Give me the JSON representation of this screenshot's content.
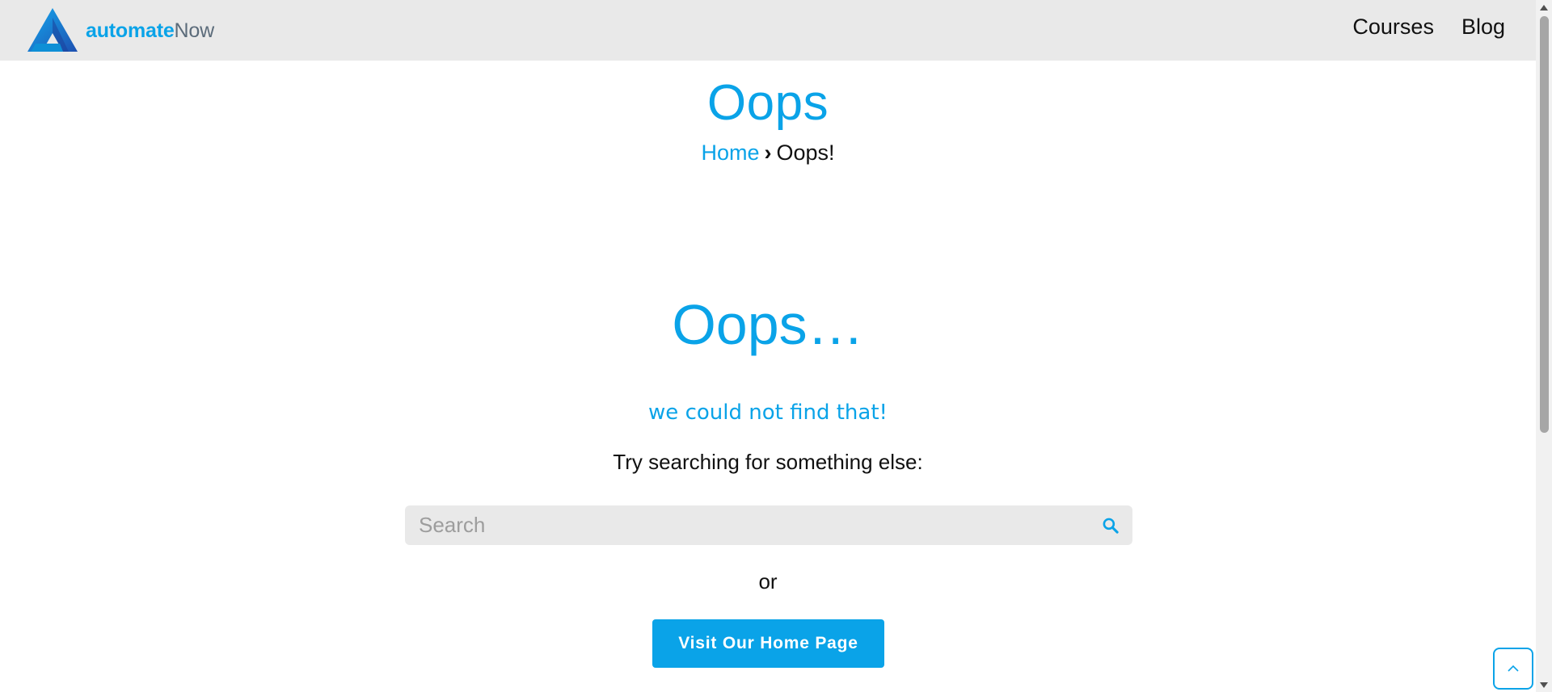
{
  "header": {
    "logo_text_bold": "automate",
    "logo_text_light": "Now",
    "nav": [
      {
        "label": "Courses"
      },
      {
        "label": "Blog"
      }
    ]
  },
  "page_title": "Oops",
  "breadcrumb": {
    "home": "Home",
    "separator": "›",
    "current": "Oops!"
  },
  "main": {
    "heading": "Oops…",
    "subheading": "we could not find that!",
    "prompt": "Try searching for something else:",
    "search": {
      "placeholder": "Search",
      "value": ""
    },
    "or_text": "or",
    "home_button": "Visit Our Home Page"
  },
  "icons": {
    "logo": "automatenow-logo-icon",
    "search": "search-icon",
    "back_to_top": "chevron-up-icon"
  },
  "colors": {
    "accent": "#0aa3e8",
    "header_bg": "#e9e9e9",
    "text": "#111111",
    "logo_gray": "#5b6b7a"
  }
}
